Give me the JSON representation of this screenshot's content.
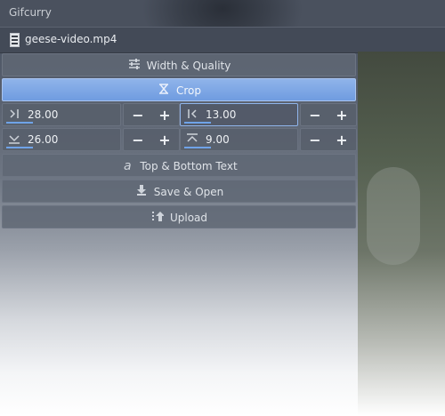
{
  "window": {
    "title": "Gifcurry"
  },
  "file": {
    "name": "geese-video.mp4",
    "icon": "film-icon"
  },
  "sections": {
    "width_quality": {
      "label": "Width & Quality",
      "icon": "sliders-icon"
    },
    "crop": {
      "label": "Crop",
      "icon": "crop-icon"
    },
    "text": {
      "label": "Top & Bottom Text",
      "icon": "text-icon"
    },
    "save": {
      "label": "Save & Open",
      "icon": "download-icon"
    },
    "upload": {
      "label": "Upload",
      "icon": "upload-icon"
    }
  },
  "crop": {
    "right": {
      "value": "28.00",
      "icon": "crop-right-icon"
    },
    "left": {
      "value": "13.00",
      "icon": "crop-left-icon"
    },
    "bottom": {
      "value": "26.00",
      "icon": "crop-bottom-icon"
    },
    "top": {
      "value": "9.00",
      "icon": "crop-top-icon"
    }
  },
  "steppers": {
    "minus": "−",
    "plus": "+"
  },
  "colors": {
    "accent": "#7aa6e6",
    "panel": "#5b6371",
    "titlebar": "#3a404b"
  }
}
